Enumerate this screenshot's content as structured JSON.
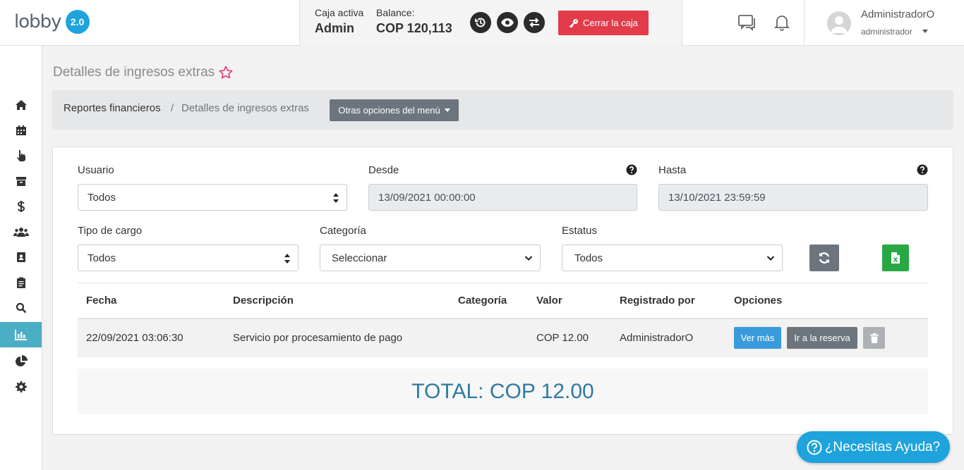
{
  "app": {
    "logo_text": "lobby",
    "logo_version": "2.0"
  },
  "cashbox": {
    "active_label": "Caja activa",
    "active_value": "Admin",
    "balance_label": "Balance:",
    "balance_value": "COP 120,113",
    "close_label": "Cerrar la caja",
    "close_color": "#e23b4a"
  },
  "user": {
    "name": "AdministradorO",
    "role": "administrador"
  },
  "sidebar": {
    "items": [
      "home-icon",
      "calendar-icon",
      "pointer-hand-icon",
      "archive-icon",
      "dollar-icon",
      "users-icon",
      "address-book-icon",
      "clipboard-icon",
      "search-icon",
      "bar-chart-icon",
      "pie-chart-icon",
      "gear-icon"
    ],
    "active_item": "bar-chart-icon",
    "active_color": "#4aaec4"
  },
  "page": {
    "title": "Detalles de ingresos extras"
  },
  "breadcrumb": {
    "parent": "Reportes financieros",
    "separator": "/",
    "current": "Detalles de ingresos extras",
    "menu_button": "Otras opciones del menú"
  },
  "filters": {
    "usuario_label": "Usuario",
    "usuario_value": "Todos",
    "desde_label": "Desde",
    "desde_value": "13/09/2021 00:00:00",
    "hasta_label": "Hasta",
    "hasta_value": "13/10/2021 23:59:59",
    "tipo_label": "Tipo de cargo",
    "tipo_value": "Todos",
    "categoria_label": "Categoría",
    "categoria_value": "Seleccionar",
    "estatus_label": "Estatus",
    "estatus_value": "Todos"
  },
  "table": {
    "headers": [
      "Fecha",
      "Descripción",
      "Categoría",
      "Valor",
      "Registrado por",
      "Opciones"
    ],
    "rows": [
      {
        "fecha": "22/09/2021 03:06:30",
        "descripcion": "Servicio por procesamiento de pago",
        "categoria": "",
        "valor": "COP 12.00",
        "registrado_por": "AdministradorO",
        "ver_mas": "Ver más",
        "ir_reserva": "Ir a la reserva"
      }
    ]
  },
  "total": "TOTAL: COP 12.00",
  "help": {
    "label": "¿Necesitas Ayuda?"
  },
  "colors": {
    "brand_blue": "#1ea3dd",
    "primary_btn": "#3a9bdc",
    "secondary_btn": "#6c757d",
    "excel_green": "#28a745",
    "total_text": "#2e7aa2"
  }
}
